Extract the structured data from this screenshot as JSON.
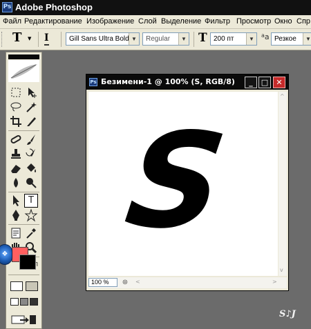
{
  "app": {
    "title": "Adobe Photoshop",
    "icon": "photoshop-icon"
  },
  "menu": [
    "Файл",
    "Редактирование",
    "Изображение",
    "Слой",
    "Выделение",
    "Фильтр",
    "Просмотр",
    "Окно",
    "Спр"
  ],
  "options": {
    "tool_glyph": "T",
    "orient_glyph": "I",
    "font_family": "Gill Sans Ultra Bold",
    "font_style": "Regular",
    "size_glyph": "T",
    "font_size": "200 пт",
    "aa_glyph": "a",
    "antialias": "Резкое"
  },
  "toolbox": {
    "foreground_color": "#ff5f5f",
    "background_color": "#000000",
    "tools": [
      "marquee-icon",
      "move-icon",
      "lasso-icon",
      "magic-wand-icon",
      "crop-icon",
      "slice-icon",
      "healing-brush-icon",
      "brush-icon",
      "clone-stamp-icon",
      "history-brush-icon",
      "eraser-icon",
      "paint-bucket-icon",
      "blur-icon",
      "dodge-icon",
      "path-selection-icon",
      "type-icon",
      "pen-icon",
      "custom-shape-icon",
      "notes-icon",
      "eyedropper-icon",
      "hand-icon",
      "zoom-icon"
    ],
    "type_tool_glyph": "T"
  },
  "document": {
    "title": "Безимени-1 @ 100% (S, RGB/8)",
    "canvas_letter": "S",
    "zoom": "100 %",
    "minimize_glyph": "_",
    "maximize_glyph": "□",
    "close_glyph": "✕"
  },
  "watermark": "S♪J"
}
